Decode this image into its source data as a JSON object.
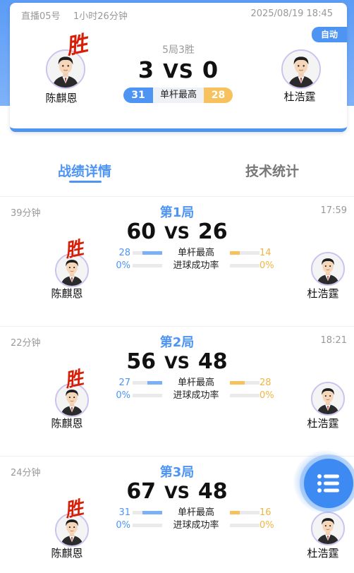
{
  "header": {
    "room": "直播05号",
    "duration": "1小时26分钟",
    "datetime": "2025/08/19 18:45",
    "mode_badge": "自动",
    "format": "5局3胜",
    "left_score": "3",
    "right_score": "0",
    "vs": "VS",
    "left_player": "陈麒恩",
    "right_player": "杜浩霆",
    "win_text": "胜",
    "high_break_label": "单杆最高",
    "left_high_break": "31",
    "right_high_break": "28"
  },
  "tabs": {
    "active": "战绩详情",
    "inactive": "技术统计"
  },
  "games": [
    {
      "duration": "39分钟",
      "title": "第1局",
      "time": "17:59",
      "left_score": "60",
      "right_score": "26",
      "vs": "VS",
      "winner_text": "胜",
      "left_player": "陈麒恩",
      "right_player": "杜浩霆",
      "stats": [
        {
          "label": "单杆最高",
          "left": "28",
          "right": "14",
          "left_fill": 0.67,
          "right_fill": 0.33
        },
        {
          "label": "进球成功率",
          "left": "0%",
          "right": "0%",
          "left_fill": 0,
          "right_fill": 0
        }
      ]
    },
    {
      "duration": "22分钟",
      "title": "第2局",
      "time": "18:21",
      "left_score": "56",
      "right_score": "48",
      "vs": "VS",
      "winner_text": "胜",
      "left_player": "陈麒恩",
      "right_player": "杜浩霆",
      "stats": [
        {
          "label": "单杆最高",
          "left": "27",
          "right": "28",
          "left_fill": 0.49,
          "right_fill": 0.51
        },
        {
          "label": "进球成功率",
          "left": "0%",
          "right": "0%",
          "left_fill": 0,
          "right_fill": 0
        }
      ]
    },
    {
      "duration": "24分钟",
      "title": "第3局",
      "time": "",
      "left_score": "67",
      "right_score": "48",
      "vs": "VS",
      "winner_text": "胜",
      "left_player": "陈麒恩",
      "right_player": "杜浩霆",
      "stats": [
        {
          "label": "单杆最高",
          "left": "31",
          "right": "16",
          "left_fill": 0.66,
          "right_fill": 0.34
        },
        {
          "label": "进球成功率",
          "left": "0%",
          "right": "0%",
          "left_fill": 0,
          "right_fill": 0
        }
      ]
    }
  ],
  "colors": {
    "primary": "#4e95f3",
    "secondary": "#f7c25e",
    "win": "#d81e06"
  },
  "icons": {
    "fab": "list-menu-icon",
    "avatar": "player-avatar-icon"
  }
}
